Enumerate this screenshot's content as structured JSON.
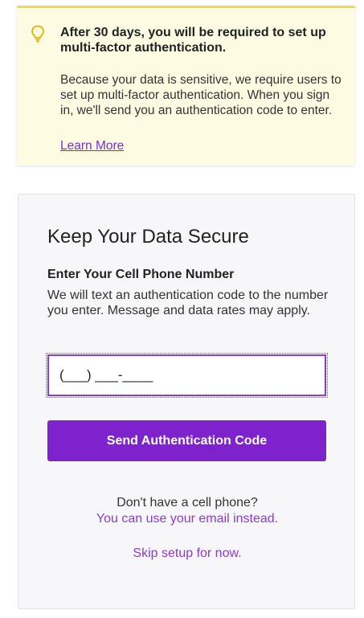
{
  "notice": {
    "icon": "lightbulb-icon",
    "title": "After 30 days, you will be required to set up multi-factor authentication.",
    "body": "Because your data is sensitive, we require users to set up multi-factor authentication. When you sign in, we'll send you an authentication code to enter.",
    "link": "Learn More",
    "colors": {
      "background": "#fdfce2",
      "border": "#e9da4e",
      "icon": "#e0b300"
    }
  },
  "secure": {
    "title": "Keep Your Data Secure",
    "field_label": "Enter Your Cell Phone Number",
    "field_help": "We will text an authentication code to the number you enter. Message and data rates may apply.",
    "phone_value": "(___) ___-____",
    "send_button": "Send Authentication Code",
    "no_phone": "Don't have a cell phone?",
    "email_link": "You can use your email instead.",
    "skip_link": "Skip setup for now."
  },
  "colors": {
    "accent": "#7e22ce",
    "link": "#8a3ad6"
  }
}
